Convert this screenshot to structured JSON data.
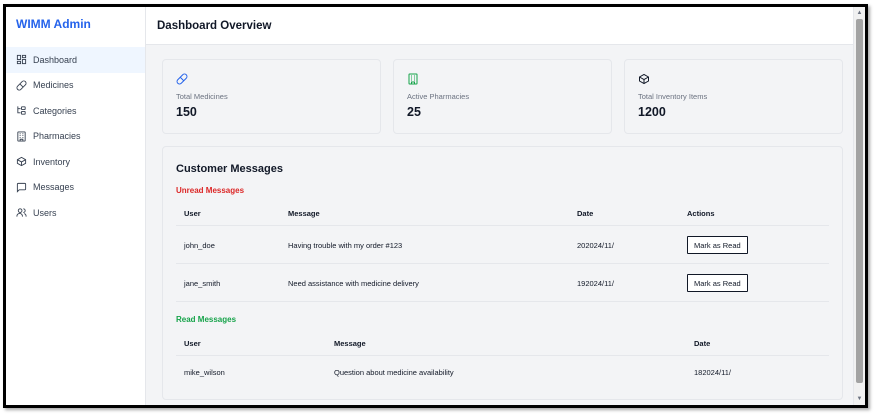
{
  "sidebar": {
    "brand": "WIMM Admin",
    "items": [
      {
        "label": "Dashboard",
        "icon": "dashboard-icon"
      },
      {
        "label": "Medicines",
        "icon": "pill-icon"
      },
      {
        "label": "Categories",
        "icon": "category-tree-icon"
      },
      {
        "label": "Pharmacies",
        "icon": "building-icon"
      },
      {
        "label": "Inventory",
        "icon": "box-icon"
      },
      {
        "label": "Messages",
        "icon": "message-icon"
      },
      {
        "label": "Users",
        "icon": "users-icon"
      }
    ]
  },
  "header": {
    "title": "Dashboard Overview"
  },
  "stats": [
    {
      "label": "Total Medicines",
      "value": "150",
      "icon": "pill-icon",
      "color": "#2563eb"
    },
    {
      "label": "Active Pharmacies",
      "value": "25",
      "icon": "building-icon",
      "color": "#16a34a"
    },
    {
      "label": "Total Inventory Items",
      "value": "1200",
      "icon": "box-icon",
      "color": "#111827"
    }
  ],
  "messages": {
    "title": "Customer Messages",
    "unread": {
      "label": "Unread Messages",
      "columns": [
        "User",
        "Message",
        "Date",
        "Actions"
      ],
      "rows": [
        {
          "user": "john_doe",
          "message": "Having trouble with my order #123",
          "date": "202024/11/",
          "action": "Mark as Read"
        },
        {
          "user": "jane_smith",
          "message": "Need assistance with medicine delivery",
          "date": "192024/11/",
          "action": "Mark as Read"
        }
      ]
    },
    "read": {
      "label": "Read Messages",
      "columns": [
        "User",
        "Message",
        "Date"
      ],
      "rows": [
        {
          "user": "mike_wilson",
          "message": "Question about medicine availability",
          "date": "182024/11/"
        }
      ]
    }
  },
  "colors": {
    "accent": "#2563eb",
    "unread": "#dc2626",
    "read": "#16a34a"
  }
}
